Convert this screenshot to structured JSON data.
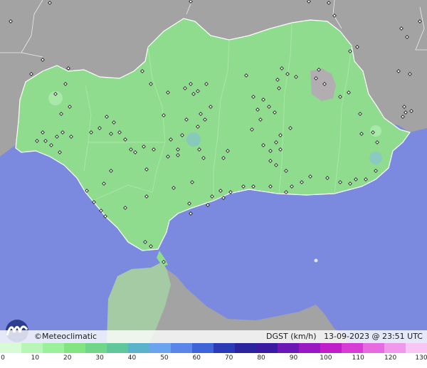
{
  "credit": "©Meteoclimatic",
  "variable": "DGST (km/h)",
  "timestamp": "13-09-2023 @ 23:51 UTC",
  "scale": {
    "ticks": [
      "0",
      "10",
      "20",
      "30",
      "40",
      "50",
      "60",
      "70",
      "80",
      "90",
      "100",
      "110",
      "120",
      "130"
    ],
    "colors": [
      "#d6fbd6",
      "#b8f6b8",
      "#9bf09b",
      "#82e582",
      "#6fd68a",
      "#5fc79a",
      "#5ab3c8",
      "#6aa4ee",
      "#5a86ea",
      "#3f63d8",
      "#2b3bb8",
      "#2a249e",
      "#3a1aa0",
      "#6a18b6",
      "#9a18c4",
      "#c01ec8",
      "#d83cd6",
      "#e66ae0",
      "#f098ec",
      "#f7c6f5"
    ]
  },
  "colors": {
    "sea": "#7b8adf",
    "land_outside": "#a6a6a6",
    "andalucia": "#8fdc8f",
    "border": "#ffffff"
  },
  "stations_note_icon": "station-dot-icon"
}
